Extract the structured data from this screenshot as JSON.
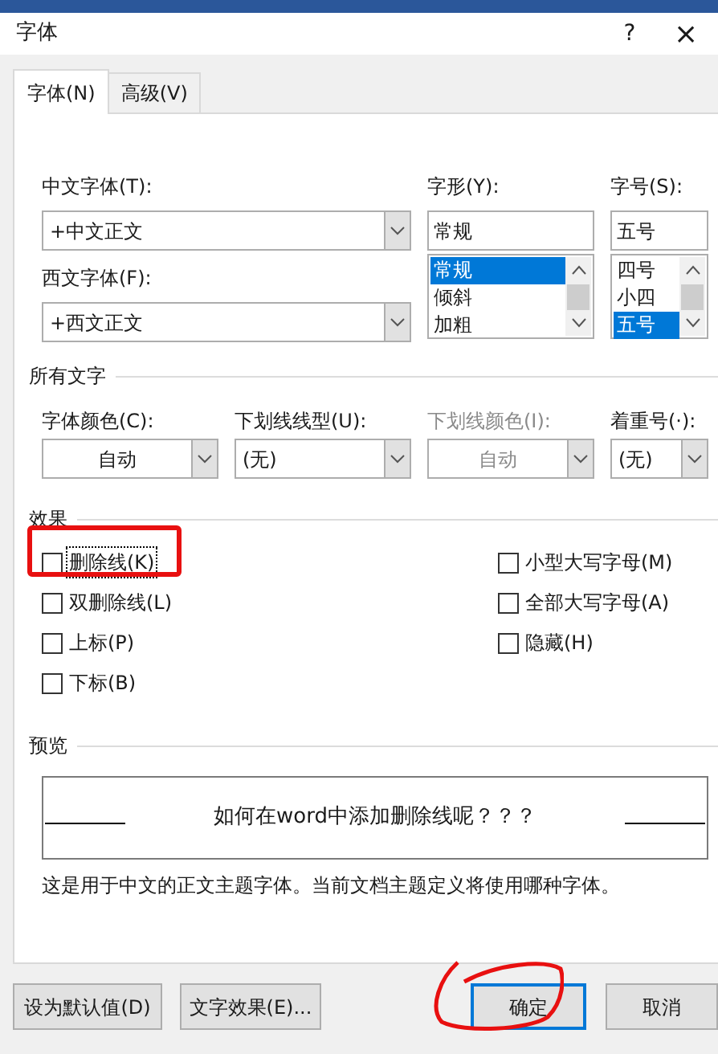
{
  "window": {
    "title": "字体",
    "help": "?",
    "close": "×"
  },
  "tabs": [
    {
      "label": "字体(N)",
      "selected": true
    },
    {
      "label": "高级(V)",
      "selected": false
    }
  ],
  "font": {
    "chinese_font": {
      "label": "中文字体(T):",
      "value": "+中文正文"
    },
    "western_font": {
      "label": "西文字体(F):",
      "value": "+西文正文"
    },
    "style": {
      "label": "字形(Y):",
      "value": "常规",
      "options": [
        {
          "label": "常规",
          "selected": true
        },
        {
          "label": "倾斜",
          "selected": false
        },
        {
          "label": "加粗",
          "selected": false
        }
      ]
    },
    "size": {
      "label": "字号(S):",
      "value": "五号",
      "options": [
        {
          "label": "四号",
          "selected": false
        },
        {
          "label": "小四",
          "selected": false
        },
        {
          "label": "五号",
          "selected": true
        }
      ]
    }
  },
  "all_text": {
    "heading": "所有文字",
    "fields": [
      {
        "label": "字体颜色(C):",
        "value": "自动",
        "kind": "color",
        "disabled": false
      },
      {
        "label": "下划线线型(U):",
        "value": "(无)",
        "kind": "list",
        "disabled": false
      },
      {
        "label": "下划线颜色(I):",
        "value": "自动",
        "kind": "color",
        "disabled": true
      },
      {
        "label": "着重号(·):",
        "value": "(无)",
        "kind": "list",
        "disabled": false
      }
    ]
  },
  "effects": {
    "heading": "效果",
    "left": [
      {
        "label": "删除线(K)",
        "checked": false,
        "focused": true
      },
      {
        "label": "双删除线(L)",
        "checked": false,
        "focused": false
      },
      {
        "label": "上标(P)",
        "checked": false,
        "focused": false
      },
      {
        "label": "下标(B)",
        "checked": false,
        "focused": false
      }
    ],
    "right": [
      {
        "label": "小型大写字母(M)",
        "checked": false,
        "focused": false
      },
      {
        "label": "全部大写字母(A)",
        "checked": false,
        "focused": false
      },
      {
        "label": "隐藏(H)",
        "checked": false,
        "focused": false
      }
    ]
  },
  "preview": {
    "heading": "预览",
    "sample": "如何在word中添加删除线呢？？？",
    "description": "这是用于中文的正文主题字体。当前文档主题定义将使用哪种字体。"
  },
  "buttons": [
    {
      "label": "设为默认值(D)",
      "default": false
    },
    {
      "label": "文字效果(E)...",
      "default": false
    },
    {
      "label": "确定",
      "default": true
    },
    {
      "label": "取消",
      "default": false
    }
  ]
}
